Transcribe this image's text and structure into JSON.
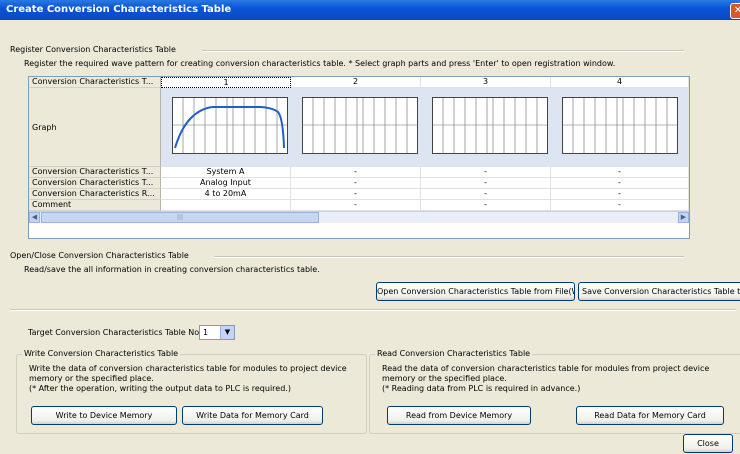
{
  "window": {
    "title": "Create Conversion Characteristics Table",
    "close_glyph": "✕"
  },
  "register": {
    "title": "Register Conversion Characteristics Table",
    "description": "Register the required wave pattern for creating conversion characteristics table. * Select graph parts and press 'Enter' to open registration window.",
    "row_headers": [
      "Conversion Characteristics T...",
      "Graph",
      "Conversion Characteristics T...",
      "Conversion Characteristics T...",
      "Conversion Characteristics R...",
      "Comment"
    ],
    "columns": [
      {
        "number": "1",
        "type": "System A",
        "input": "Analog Input",
        "range": "4 to 20mA",
        "comment": ""
      },
      {
        "number": "2",
        "type": "-",
        "input": "-",
        "range": "-",
        "comment": "-"
      },
      {
        "number": "3",
        "type": "-",
        "input": "-",
        "range": "-",
        "comment": "-"
      },
      {
        "number": "4",
        "type": "-",
        "input": "-",
        "range": "-",
        "comment": "-"
      }
    ]
  },
  "openclose": {
    "title": "Open/Close Conversion Characteristics Table",
    "description": "Read/save the all information in creating conversion characteristics table.",
    "open_button": "Open Conversion Characteristics Table from File(W)",
    "save_button": "Save Conversion Characteristics Table to Fi"
  },
  "target": {
    "label": "Target Conversion Characteristics Table No.",
    "value": "1"
  },
  "write_group": {
    "title": "Write Conversion Characteristics Table",
    "line1": "Write the data of conversion characteristics table for modules to project device",
    "line2": "memory or the specified place.",
    "line3": "(* After the operation, writing the output data to PLC is required.)",
    "btn_device": "Write to Device Memory",
    "btn_card": "Write Data for Memory Card"
  },
  "read_group": {
    "title": "Read Conversion Characteristics Table",
    "line1": "Read the data of conversion characteristics table for modules from project device",
    "line2": "memory or the specified place.",
    "line3": "(* Reading data from PLC is required in advance.)",
    "btn_device": "Read from Device Memory",
    "btn_card": "Read Data for Memory Card"
  },
  "close_button": "Close",
  "colors": {
    "titlebar": "#0a54d8",
    "graph_curve": "#1f5fc7",
    "dialog_bg": "#ece9d8"
  }
}
